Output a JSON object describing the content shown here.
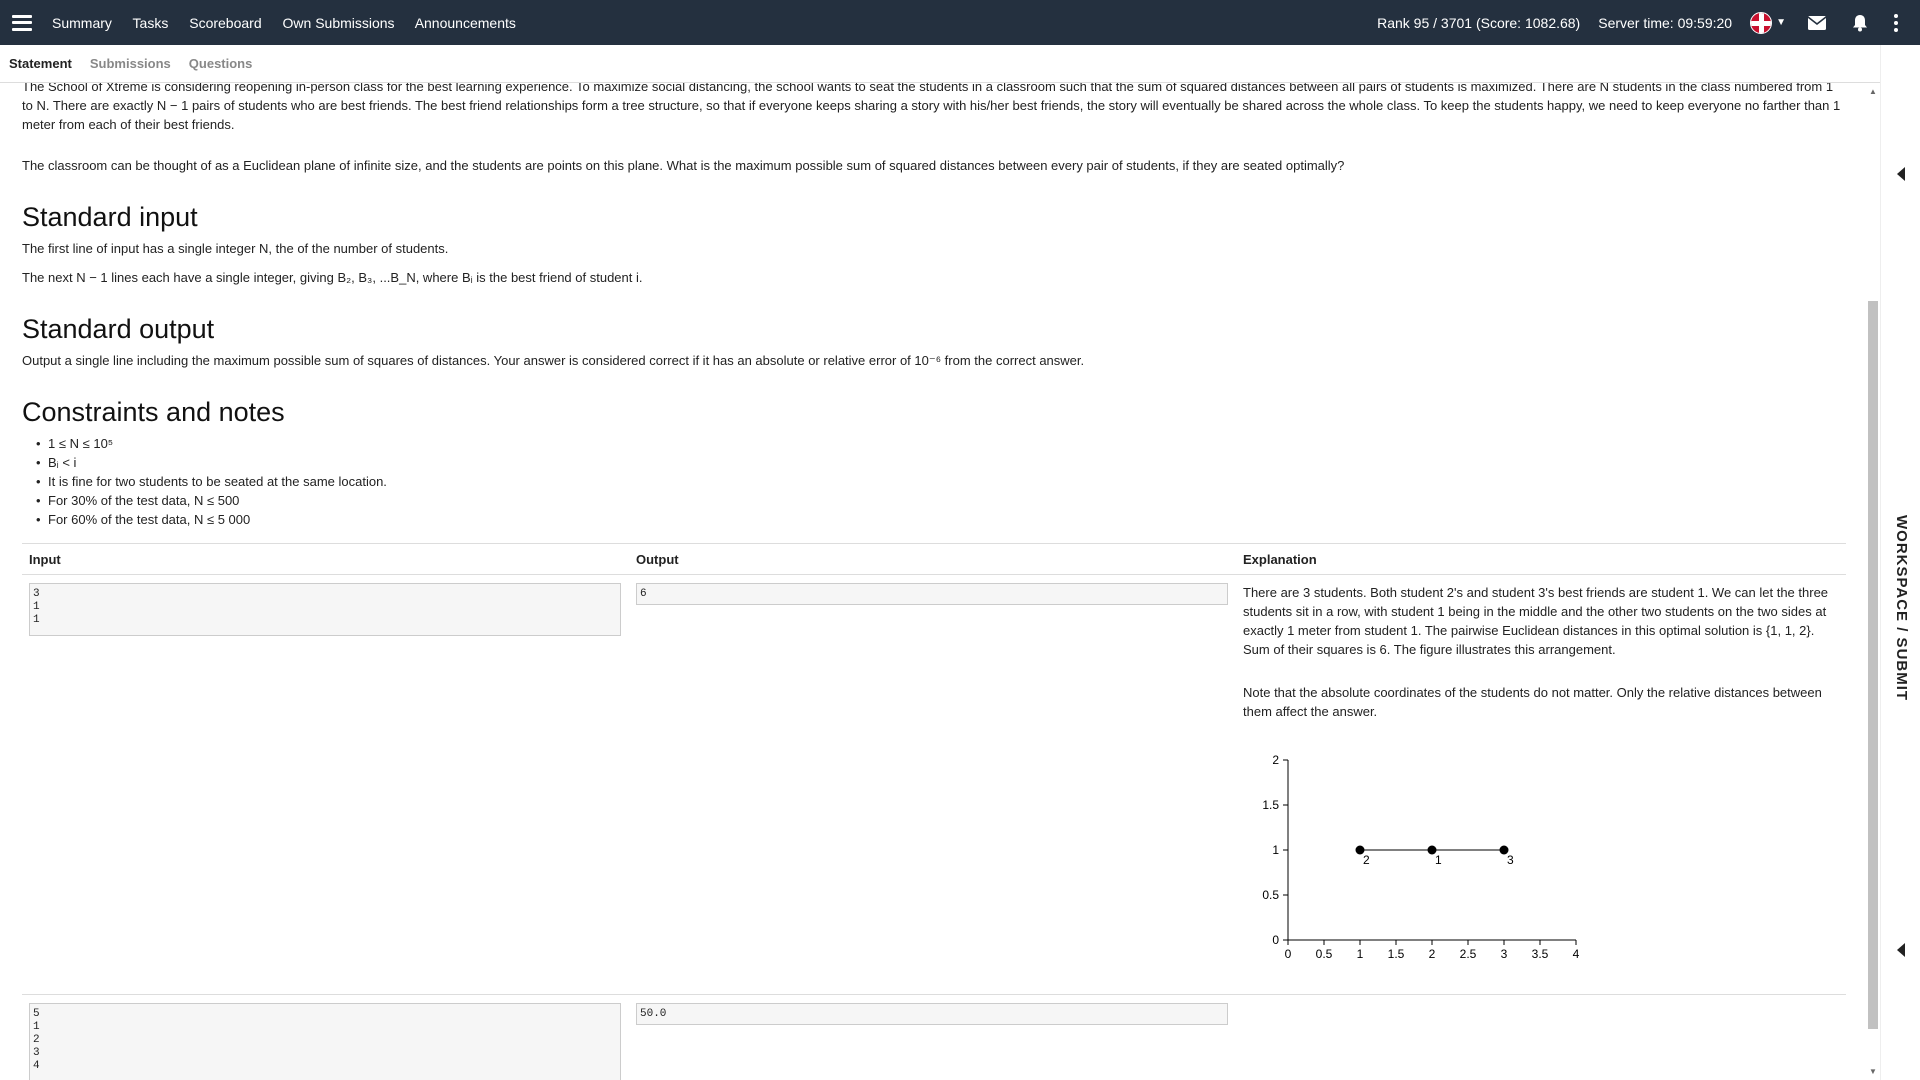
{
  "nav": {
    "items": [
      "Summary",
      "Tasks",
      "Scoreboard",
      "Own Submissions",
      "Announcements"
    ],
    "rank": "Rank 95 / 3701 (Score: 1082.68)",
    "server_time": "Server time: 09:59:20"
  },
  "subtabs": [
    "Statement",
    "Submissions",
    "Questions"
  ],
  "statement": {
    "intro_line1": "The School of Xtreme is considering reopening in-person class for the best learning experience. To maximize social distancing, the school wants to seat the students in a classroom such that the sum of squared distances between all pairs of students is maximized. There are N students in the class numbered from 1 to N. There are",
    "intro_line2": "exactly N − 1 pairs of students who are best friends. The best friend relationships form a tree structure, so that if everyone keeps sharing a story with his/her best friends, the story will eventually be shared across the whole class. To keep the students happy, we need to keep everyone no farther than 1 meter from each of their best friends.",
    "classroom": "The classroom can be thought of as a Euclidean plane of infinite size, and the students are points on this plane. What is the maximum possible sum of squared distances between every pair of students, if they are seated optimally?",
    "std_input_title": "Standard input",
    "std_input_1": "The first line of input has a single integer N, the of the number of students.",
    "std_input_2": "The next N − 1 lines each have a single integer, giving B₂, B₃, ...B_N, where Bᵢ is the best friend of student i.",
    "std_output_title": "Standard output",
    "std_output_1": "Output a single line including the maximum possible sum of squares of distances. Your answer is considered correct if it has an absolute or relative error of 10⁻⁶ from the correct answer.",
    "constraints_title": "Constraints and notes",
    "constraints": [
      "1 ≤ N ≤ 10⁵",
      "Bᵢ < i",
      "It is fine for two students to be seated at the same location.",
      "For 30% of the test data, N ≤ 500",
      "For 60% of the test data, N ≤ 5 000"
    ]
  },
  "examples": {
    "headers": [
      "Input",
      "Output",
      "Explanation"
    ],
    "rows": [
      {
        "input": "3\n1\n1",
        "output": "6",
        "explanation_1": "There are 3 students. Both student 2's and student 3's best friends are student 1. We can let the three students sit in a row, with student 1 being in the middle and the other two students on the two sides at exactly 1 meter from student 1. The pairwise Euclidean distances in this optimal solution is {1, 1, 2}. Sum of their squares is 6. The figure illustrates this arrangement.",
        "explanation_2": "Note that the absolute coordinates of the students do not matter. Only the relative distances between them affect the answer."
      },
      {
        "input": "5\n1\n2\n3\n4",
        "output": "50.0"
      }
    ]
  },
  "chart_data": {
    "type": "scatter",
    "points": [
      {
        "x": 1,
        "y": 1,
        "label": "2"
      },
      {
        "x": 2,
        "y": 1,
        "label": "1"
      },
      {
        "x": 3,
        "y": 1,
        "label": "3"
      }
    ],
    "edges": [
      [
        0,
        1
      ],
      [
        1,
        2
      ]
    ],
    "xlim": [
      0,
      4
    ],
    "ylim": [
      0,
      2
    ],
    "xticks": [
      "0",
      "0.5",
      "1",
      "1.5",
      "2",
      "2.5",
      "3",
      "3.5",
      "4"
    ],
    "yticks": [
      "0",
      "0.5",
      "1",
      "1.5",
      "2"
    ]
  },
  "side_panel": {
    "label": "WORKSPACE / SUBMIT"
  }
}
